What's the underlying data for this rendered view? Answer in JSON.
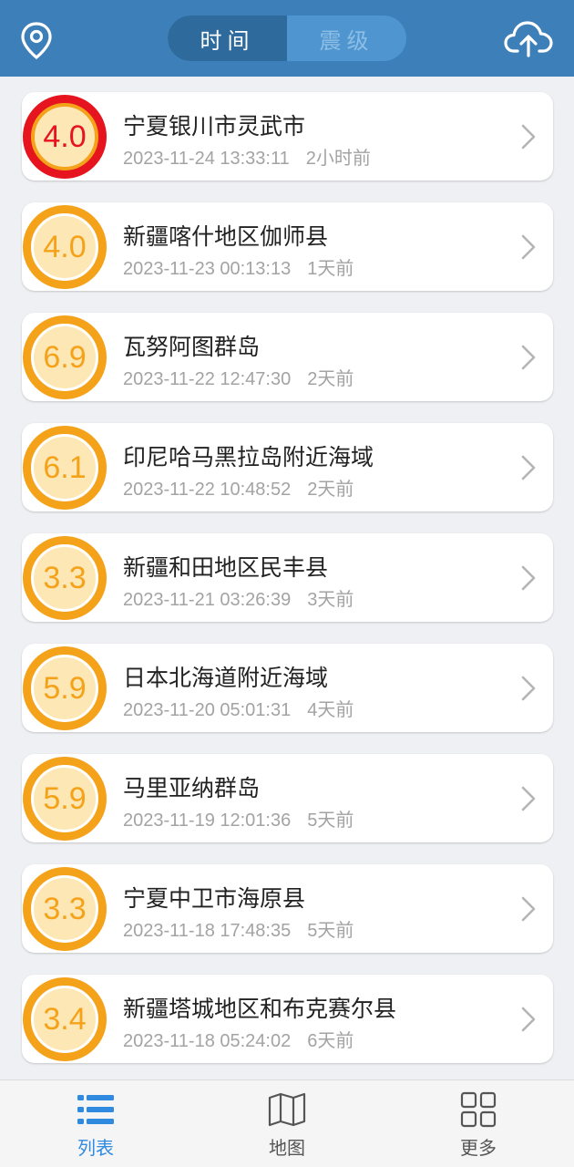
{
  "header": {
    "tabs": [
      {
        "label": "时间",
        "active": true
      },
      {
        "label": "震级",
        "active": false
      }
    ],
    "icons": {
      "left": "location-pin-icon",
      "right": "cloud-upload-icon"
    }
  },
  "colors": {
    "header_bg": "#3d7fb8",
    "accent_orange": "#f5a21b",
    "accent_red": "#e5141e",
    "nav_active": "#2f8ae0"
  },
  "quakes": [
    {
      "mag": "4.0",
      "place": "宁夏银川市灵武市",
      "time": "2023-11-24 13:33:11",
      "ago": "2小时前",
      "level": "red"
    },
    {
      "mag": "4.0",
      "place": "新疆喀什地区伽师县",
      "time": "2023-11-23 00:13:13",
      "ago": "1天前",
      "level": "orange"
    },
    {
      "mag": "6.9",
      "place": "瓦努阿图群岛",
      "time": "2023-11-22 12:47:30",
      "ago": "2天前",
      "level": "orange"
    },
    {
      "mag": "6.1",
      "place": "印尼哈马黑拉岛附近海域",
      "time": "2023-11-22 10:48:52",
      "ago": "2天前",
      "level": "orange"
    },
    {
      "mag": "3.3",
      "place": "新疆和田地区民丰县",
      "time": "2023-11-21 03:26:39",
      "ago": "3天前",
      "level": "orange"
    },
    {
      "mag": "5.9",
      "place": "日本北海道附近海域",
      "time": "2023-11-20 05:01:31",
      "ago": "4天前",
      "level": "orange"
    },
    {
      "mag": "5.9",
      "place": "马里亚纳群岛",
      "time": "2023-11-19 12:01:36",
      "ago": "5天前",
      "level": "orange"
    },
    {
      "mag": "3.3",
      "place": "宁夏中卫市海原县",
      "time": "2023-11-18 17:48:35",
      "ago": "5天前",
      "level": "orange"
    },
    {
      "mag": "3.4",
      "place": "新疆塔城地区和布克赛尔县",
      "time": "2023-11-18 05:24:02",
      "ago": "6天前",
      "level": "orange"
    }
  ],
  "bottom_nav": [
    {
      "label": "列表",
      "icon": "list-icon",
      "active": true
    },
    {
      "label": "地图",
      "icon": "map-icon",
      "active": false
    },
    {
      "label": "更多",
      "icon": "grid-icon",
      "active": false
    }
  ]
}
